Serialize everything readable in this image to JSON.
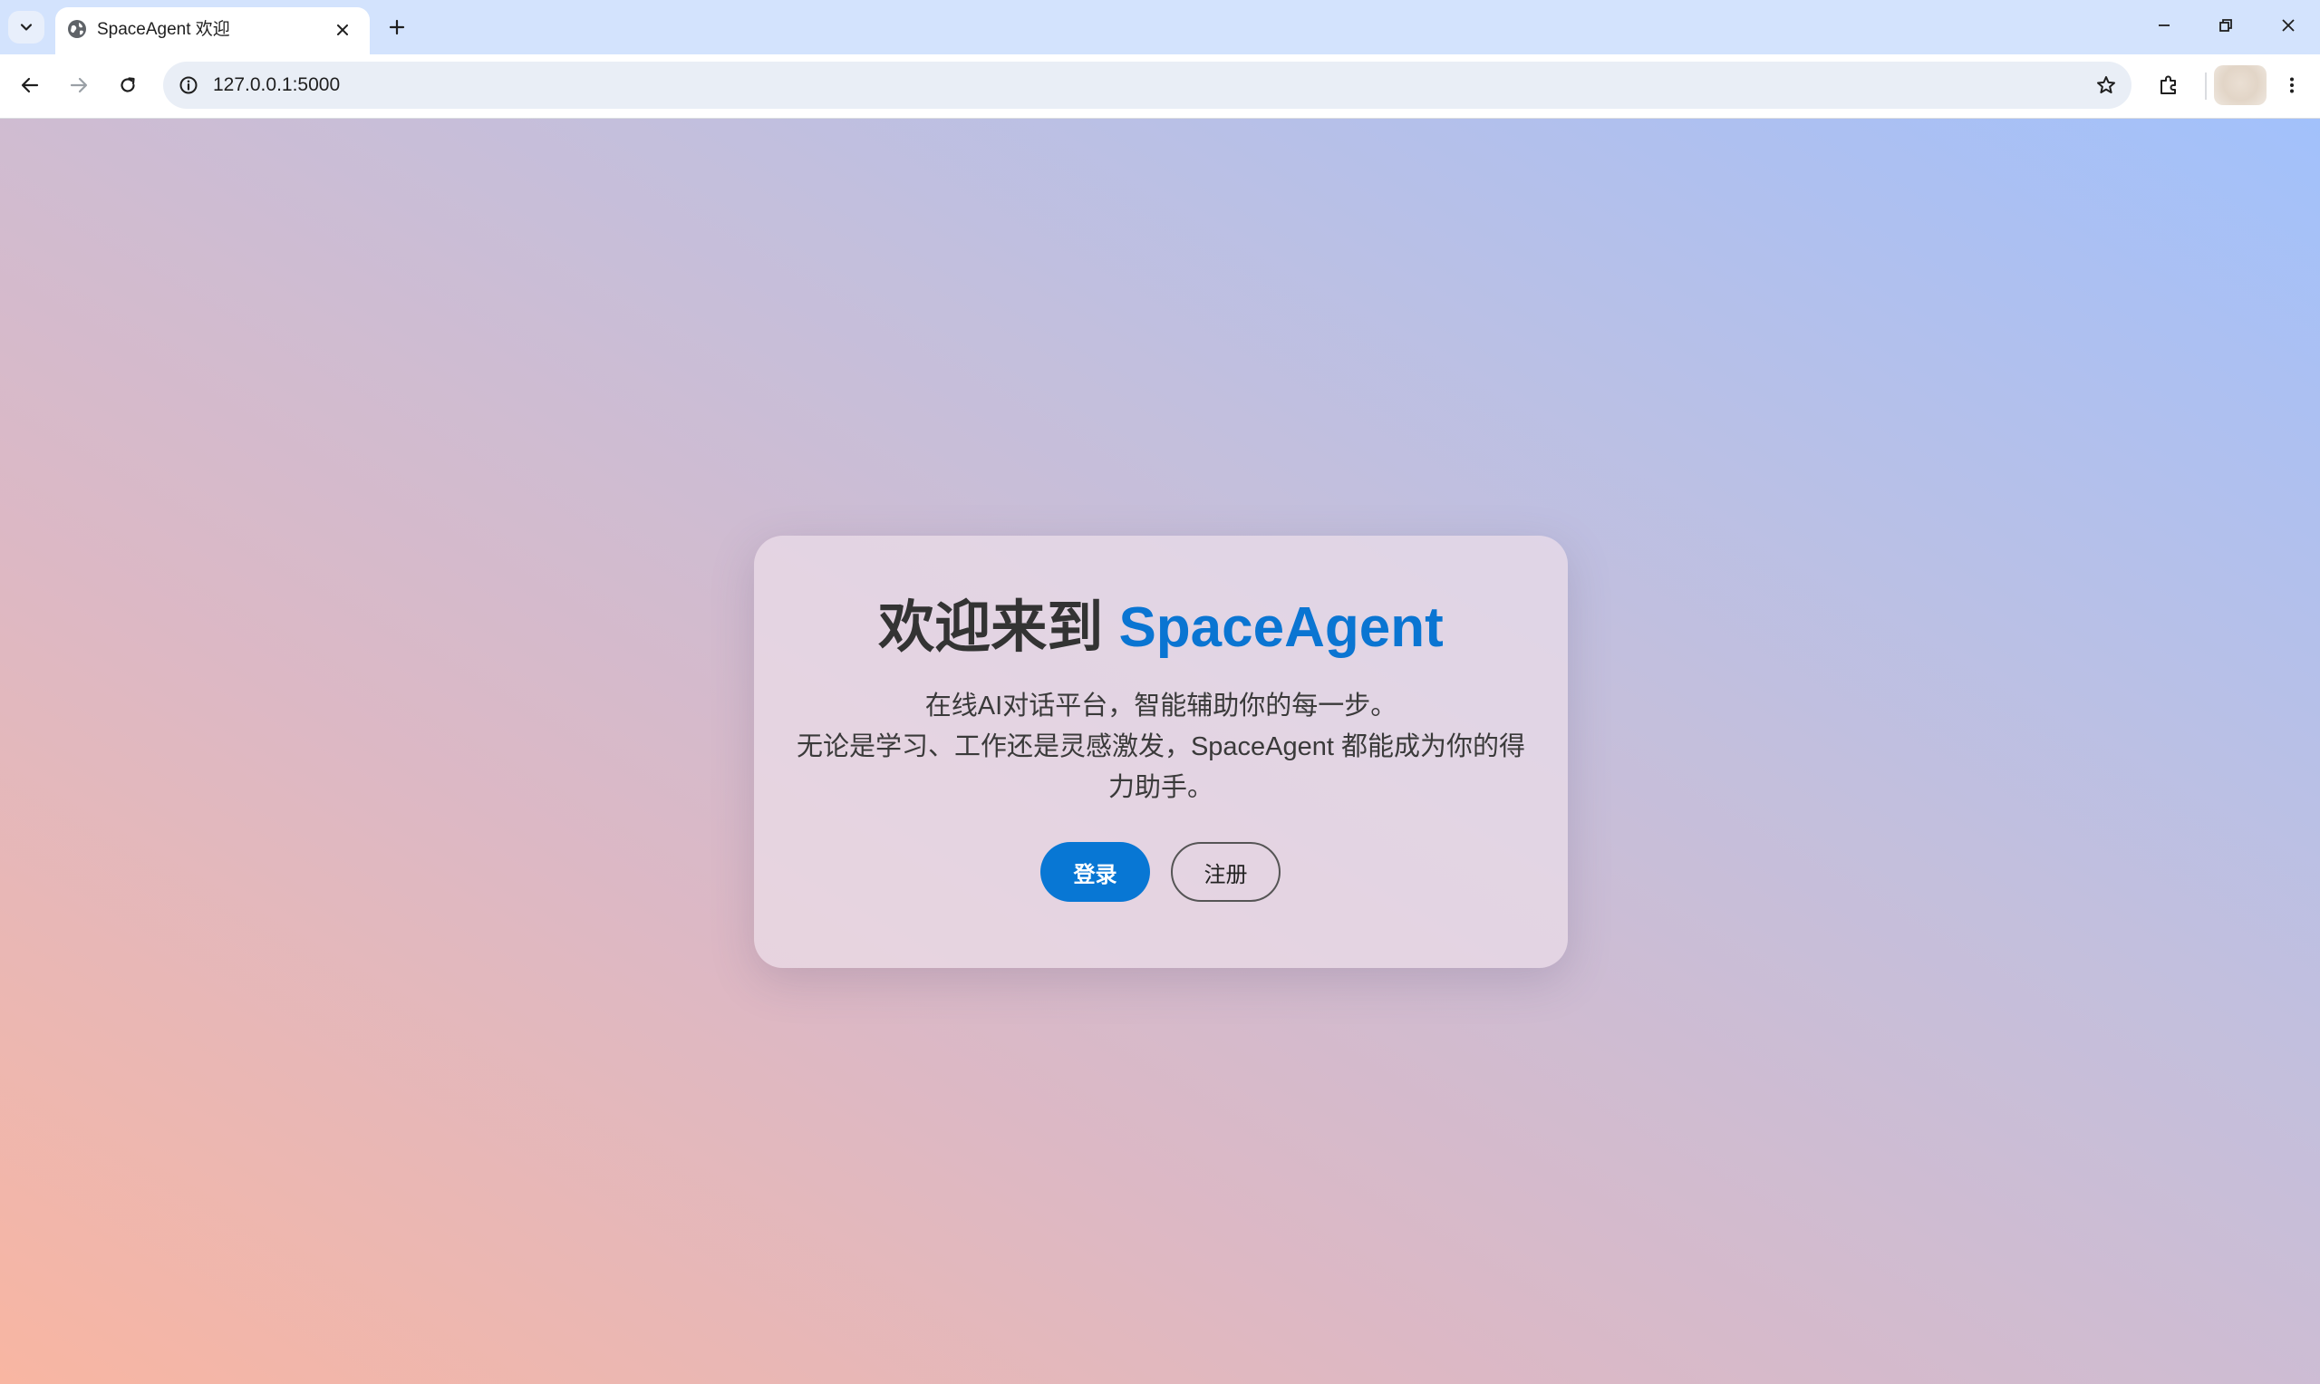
{
  "browser": {
    "tab": {
      "title": "SpaceAgent 欢迎",
      "favicon": "globe-icon"
    },
    "address_bar": {
      "url": "127.0.0.1:5000"
    },
    "icons": {
      "tab_search": "chevron-down-icon",
      "tab_close": "close-icon",
      "new_tab": "plus-icon",
      "minimize": "minimize-icon",
      "restore": "restore-icon",
      "close_window": "close-icon",
      "back": "arrow-left-icon",
      "forward": "arrow-right-icon",
      "reload": "reload-icon",
      "site_info": "info-icon",
      "bookmark": "star-icon",
      "extensions": "puzzle-icon",
      "menu": "more-vertical-icon"
    },
    "colors": {
      "tabstrip": "#d3e3fd",
      "omnibox": "#e9eef6"
    }
  },
  "welcome": {
    "title_prefix": "欢迎来到 ",
    "title_brand": "SpaceAgent",
    "description_line1": "在线AI对话平台，智能辅助你的每一步。",
    "description_line2": "无论是学习、工作还是灵感激发，SpaceAgent 都能成为你的得力助手。",
    "login_label": "登录",
    "register_label": "注册"
  },
  "colors": {
    "brand": "#0a75d2",
    "primary_button": "#0877d4",
    "gradient_start": "#f8b6a2",
    "gradient_end": "#a2c1fb"
  }
}
